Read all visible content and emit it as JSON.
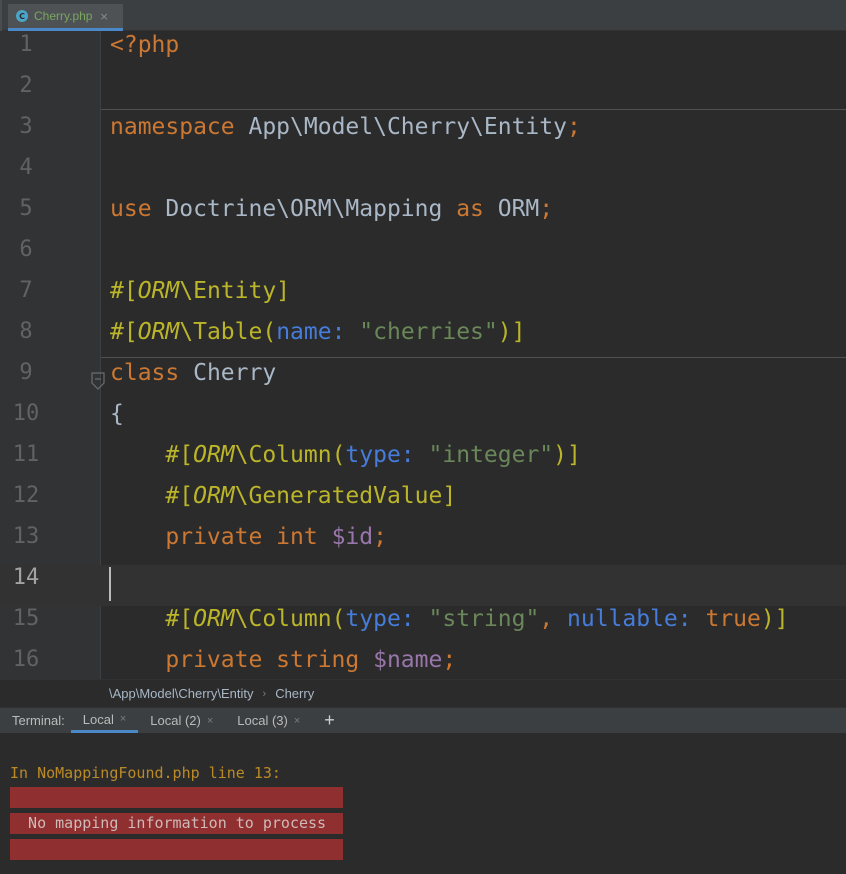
{
  "editor_tab": {
    "icon": "php-class-file-icon",
    "label": "Cherry.php",
    "close": "×"
  },
  "code_lines": [
    {
      "num": "1",
      "tokens": [
        {
          "cls": "kw",
          "text": "<?php"
        }
      ]
    },
    {
      "num": "2",
      "tokens": []
    },
    {
      "num": "3",
      "tokens": [
        {
          "cls": "kw",
          "text": "namespace "
        },
        {
          "cls": "plain",
          "text": "App\\Model\\Cherry\\Entity"
        },
        {
          "cls": "kw",
          "text": ";"
        }
      ]
    },
    {
      "num": "4",
      "tokens": []
    },
    {
      "num": "5",
      "tokens": [
        {
          "cls": "kw",
          "text": "use "
        },
        {
          "cls": "plain",
          "text": "Doctrine\\ORM\\Mapping "
        },
        {
          "cls": "kw",
          "text": "as "
        },
        {
          "cls": "plain",
          "text": "ORM"
        },
        {
          "cls": "kw",
          "text": ";"
        }
      ]
    },
    {
      "num": "6",
      "tokens": []
    },
    {
      "num": "7",
      "tokens": [
        {
          "cls": "attr",
          "text": "#["
        },
        {
          "cls": "ns",
          "text": "ORM"
        },
        {
          "cls": "attr",
          "text": "\\Entity]"
        }
      ]
    },
    {
      "num": "8",
      "tokens": [
        {
          "cls": "attr",
          "text": "#["
        },
        {
          "cls": "ns",
          "text": "ORM"
        },
        {
          "cls": "attr",
          "text": "\\Table("
        },
        {
          "cls": "param",
          "text": "name: "
        },
        {
          "cls": "str",
          "text": "\"cherries\""
        },
        {
          "cls": "attr",
          "text": ")]"
        }
      ]
    },
    {
      "num": "9",
      "tokens": [
        {
          "cls": "kw",
          "text": "class "
        },
        {
          "cls": "plain",
          "text": "Cherry"
        }
      ]
    },
    {
      "num": "10",
      "tokens": [
        {
          "cls": "plain",
          "text": "{"
        }
      ]
    },
    {
      "num": "11",
      "tokens": [
        {
          "cls": "plain",
          "text": "    "
        },
        {
          "cls": "attr",
          "text": "#["
        },
        {
          "cls": "ns",
          "text": "ORM"
        },
        {
          "cls": "attr",
          "text": "\\Column("
        },
        {
          "cls": "param",
          "text": "type: "
        },
        {
          "cls": "str",
          "text": "\"integer\""
        },
        {
          "cls": "attr",
          "text": ")]"
        }
      ]
    },
    {
      "num": "12",
      "tokens": [
        {
          "cls": "plain",
          "text": "    "
        },
        {
          "cls": "attr",
          "text": "#["
        },
        {
          "cls": "ns",
          "text": "ORM"
        },
        {
          "cls": "attr",
          "text": "\\GeneratedValue]"
        }
      ]
    },
    {
      "num": "13",
      "tokens": [
        {
          "cls": "plain",
          "text": "    "
        },
        {
          "cls": "kw",
          "text": "private int "
        },
        {
          "cls": "var",
          "text": "$id"
        },
        {
          "cls": "kw",
          "text": ";"
        }
      ]
    },
    {
      "num": "14",
      "tokens": [],
      "current": true
    },
    {
      "num": "15",
      "tokens": [
        {
          "cls": "plain",
          "text": "    "
        },
        {
          "cls": "attr",
          "text": "#["
        },
        {
          "cls": "ns",
          "text": "ORM"
        },
        {
          "cls": "attr",
          "text": "\\Column("
        },
        {
          "cls": "param",
          "text": "type: "
        },
        {
          "cls": "str",
          "text": "\"string\""
        },
        {
          "cls": "kw",
          "text": ", "
        },
        {
          "cls": "param",
          "text": "nullable: "
        },
        {
          "cls": "kw",
          "text": "true"
        },
        {
          "cls": "attr",
          "text": ")]"
        }
      ]
    },
    {
      "num": "16",
      "tokens": [
        {
          "cls": "plain",
          "text": "    "
        },
        {
          "cls": "kw",
          "text": "private string "
        },
        {
          "cls": "var",
          "text": "$name"
        },
        {
          "cls": "kw",
          "text": ";"
        }
      ]
    }
  ],
  "breadcrumb": {
    "items": [
      "\\App\\Model\\Cherry\\Entity",
      "Cherry"
    ],
    "separator": "›"
  },
  "terminal_bar": {
    "label": "Terminal:",
    "tabs": [
      {
        "label": "Local",
        "close": "×",
        "active": true
      },
      {
        "label": "Local (2)",
        "close": "×"
      },
      {
        "label": "Local (3)",
        "close": "×"
      }
    ],
    "add": "+"
  },
  "terminal": {
    "line": "In NoMappingFound.php line 13:",
    "error_lines": [
      "",
      "  No mapping information to process",
      ""
    ]
  },
  "colors": {
    "background": "#2b2b2b",
    "keyword": "#cc7832",
    "attribute": "#bbb529",
    "string": "#6a8759",
    "param_name": "#467cda",
    "variable": "#9876aa",
    "error_background": "#8f2f2f"
  }
}
